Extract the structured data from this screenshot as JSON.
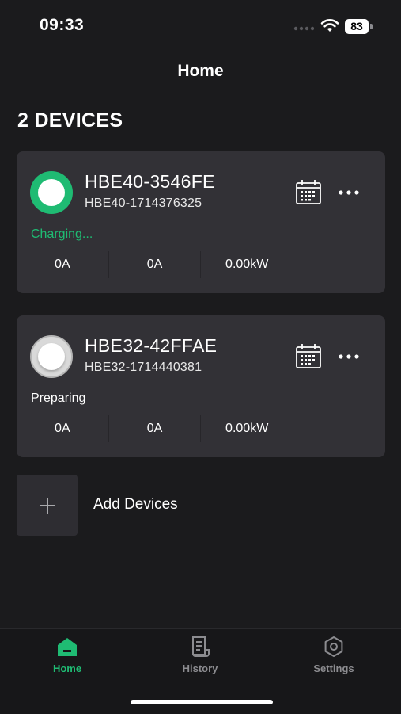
{
  "status_bar": {
    "time": "09:33",
    "battery": "83"
  },
  "header": {
    "title": "Home"
  },
  "device_count": "2 DEVICES",
  "devices": [
    {
      "name": "HBE40-3546FE",
      "serial": "HBE40-1714376325",
      "status": "Charging...",
      "status_color": "#1fbb73",
      "stats": [
        "0A",
        "0A",
        "0.00kW"
      ]
    },
    {
      "name": "HBE32-42FFAE",
      "serial": "HBE32-1714440381",
      "status": "Preparing",
      "status_color": "#ffffff",
      "stats": [
        "0A",
        "0A",
        "0.00kW"
      ]
    }
  ],
  "add_devices": {
    "label": "Add Devices",
    "icon": "plus-icon"
  },
  "tab_bar": {
    "active_color": "#1fbb73",
    "items": [
      {
        "label": "Home",
        "icon": "home-icon",
        "active": true
      },
      {
        "label": "History",
        "icon": "history-icon",
        "active": false
      },
      {
        "label": "Settings",
        "icon": "settings-icon",
        "active": false
      }
    ]
  }
}
